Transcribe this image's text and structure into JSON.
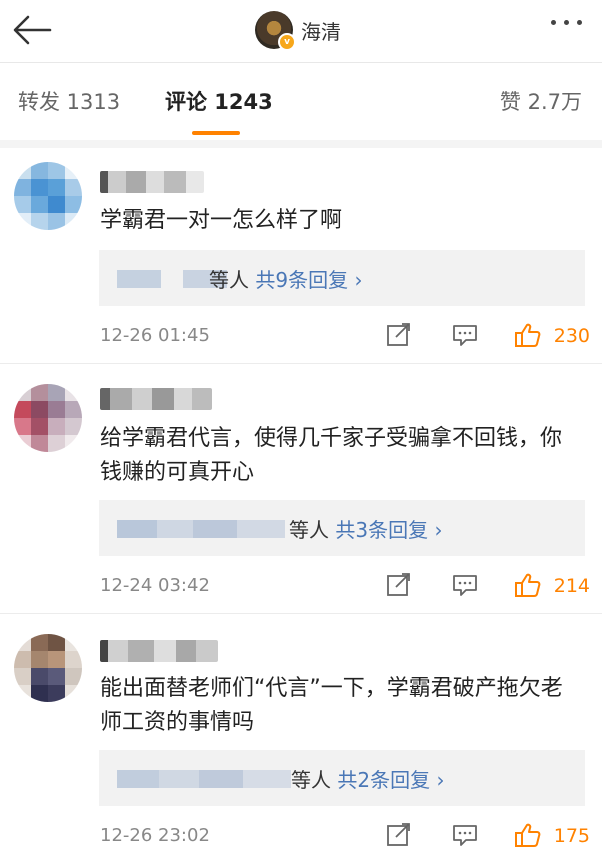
{
  "header": {
    "title": "海清",
    "vip_badge": "v",
    "back_icon": "arrow-left-icon",
    "more_icon": "more-dots-icon"
  },
  "tabs": [
    {
      "label": "转发 1313"
    },
    {
      "label": "评论 1243"
    },
    {
      "label": "赞 2.7万"
    }
  ],
  "accent_color": "#ff8200",
  "link_color": "#4a77b6",
  "comments": [
    {
      "text": "学霸君一对一怎么样了啊",
      "reply_suffix": "等人",
      "reply_link": "共9条回复 ›",
      "time": "12-26 01:45",
      "likes": "230"
    },
    {
      "text": "给学霸君代言，使得几千家子受骗拿不回钱，你钱赚的可真开心",
      "reply_suffix": "等人",
      "reply_link": "共3条回复 ›",
      "time": "12-24 03:42",
      "likes": "214"
    },
    {
      "text": "能出面替老师们“代言”一下，学霸君破产拖欠老师工资的事情吗",
      "reply_suffix": "等人",
      "reply_link": "共2条回复 ›",
      "time": "12-26 23:02",
      "likes": "175"
    }
  ]
}
